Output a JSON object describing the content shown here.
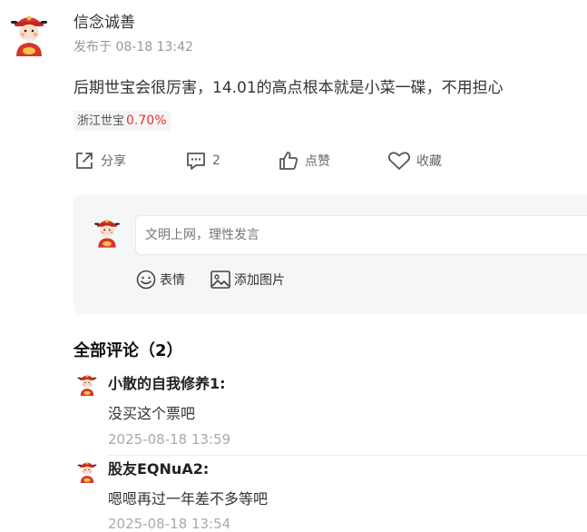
{
  "post": {
    "author": "信念诚善",
    "time_label": "发布于 08-18 13:42",
    "content": "后期世宝会很厉害，14.01的高点根本就是小菜一碟，不用担心",
    "stock": {
      "name": "浙江世宝",
      "change": "0.70%",
      "change_color": "#e93030"
    }
  },
  "actions": {
    "share": "分享",
    "comment_count": "2",
    "like": "点赞",
    "favorite": "收藏"
  },
  "reply": {
    "placeholder": "文明上网，理性发言",
    "emoji_label": "表情",
    "image_label": "添加图片"
  },
  "comments_section": {
    "title": "全部评论（2）",
    "items": [
      {
        "name": "小散的自我修养1:",
        "text": "没买这个票吧",
        "time": "2025-08-18 13:59"
      },
      {
        "name": "股友EQNuA2:",
        "text": "嗯嗯再过一年差不多等吧",
        "time": "2025-08-18 13:54"
      }
    ]
  },
  "icons": {
    "avatar": "caishen-avatar-icon",
    "share": "share-icon",
    "comment": "comment-icon",
    "like": "thumbs-up-icon",
    "favorite": "heart-icon",
    "emoji": "emoji-icon",
    "image": "image-icon"
  }
}
